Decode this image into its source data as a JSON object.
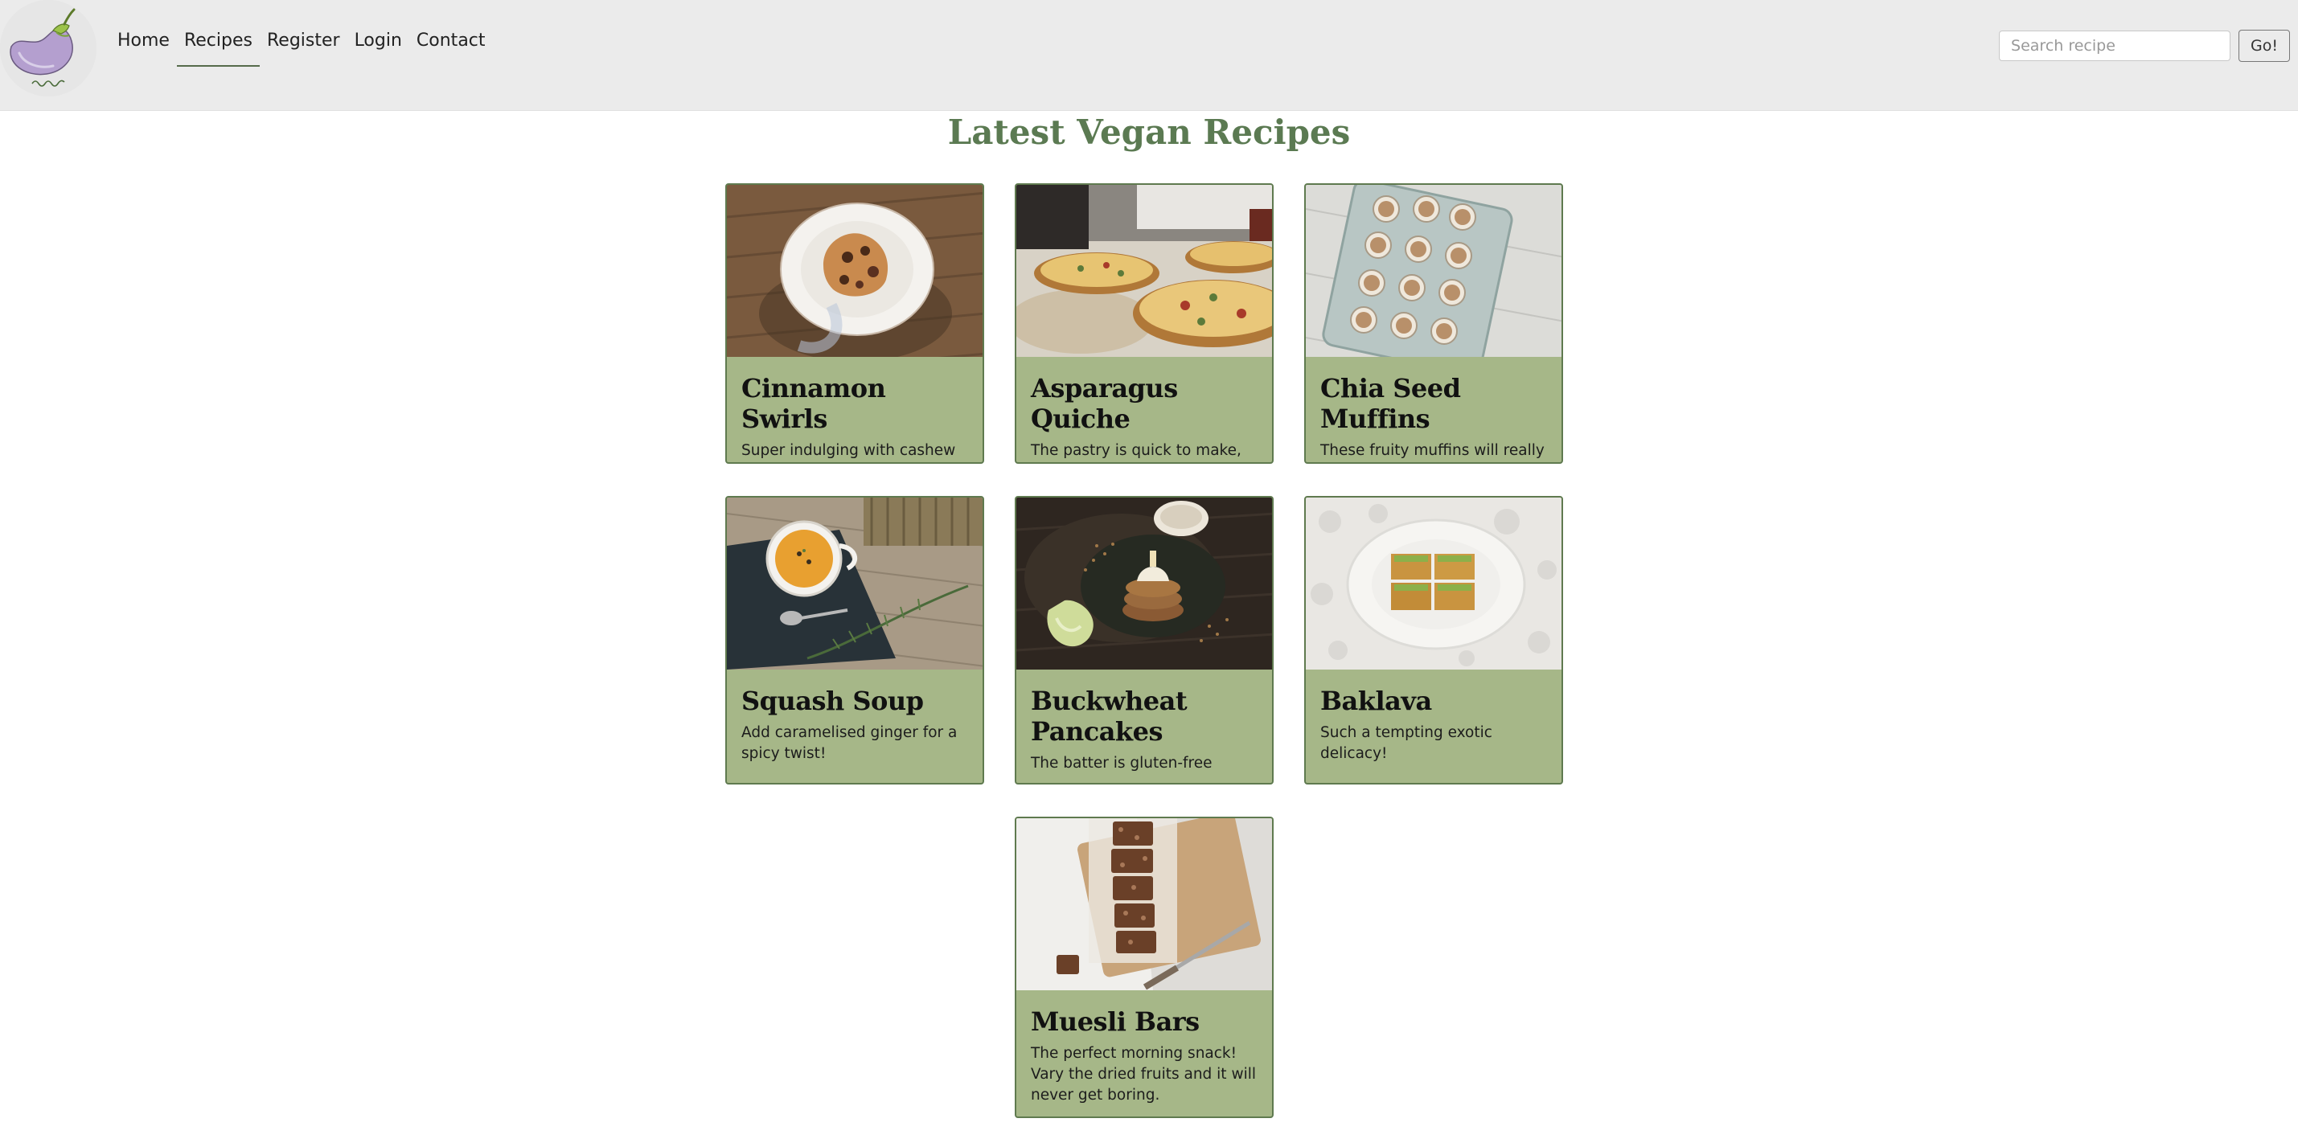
{
  "nav": {
    "items": [
      {
        "label": "Home",
        "active": false
      },
      {
        "label": "Recipes",
        "active": true
      },
      {
        "label": "Register",
        "active": false
      },
      {
        "label": "Login",
        "active": false
      },
      {
        "label": "Contact",
        "active": false
      }
    ]
  },
  "search": {
    "placeholder": "Search recipe",
    "value": "",
    "button_label": "Go!"
  },
  "page": {
    "title": "Latest Vegan Recipes"
  },
  "recipes": [
    {
      "title": "Cinnamon Swirls",
      "description": "Super indulging with cashew maple icing",
      "image": "cinnamon-swirl-photo"
    },
    {
      "title": "Asparagus Quiche",
      "description": "The pastry is quick to make, just add the filling.",
      "image": "quiche-photo"
    },
    {
      "title": "Chia Seed Muffins",
      "description": "These fruity muffins will really sweeten up your day!",
      "image": "muffins-photo"
    },
    {
      "title": "Squash Soup",
      "description": "Add caramelised ginger for a spicy twist!",
      "image": "soup-photo"
    },
    {
      "title": "Buckwheat Pancakes",
      "description": "The batter is gluten-free",
      "image": "pancakes-photo"
    },
    {
      "title": "Baklava",
      "description": "Such a tempting exotic delicacy!",
      "image": "baklava-photo"
    },
    {
      "title": "Muesli Bars",
      "description": "The perfect morning snack! Vary the dried fruits and it will never get boring.",
      "image": "muesli-bars-photo"
    }
  ],
  "colors": {
    "accent": "#5b7a52",
    "card_bg": "#a6b788",
    "card_border": "#5f7a4f",
    "navbar_bg": "#ebebeb"
  }
}
